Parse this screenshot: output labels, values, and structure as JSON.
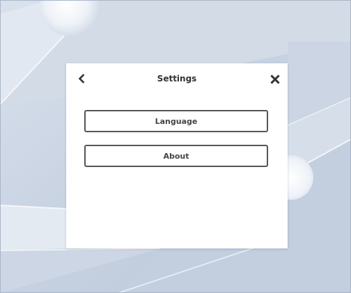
{
  "dialog": {
    "title": "Settings",
    "back_icon": "chevron-left-icon",
    "close_icon": "close-x-icon",
    "buttons": [
      {
        "label": "Language"
      },
      {
        "label": "About"
      }
    ]
  },
  "colors": {
    "wallpaper": "#c9d4e3",
    "dialog_background": "#ffffff",
    "button_border": "#555555",
    "text": "#333333"
  }
}
